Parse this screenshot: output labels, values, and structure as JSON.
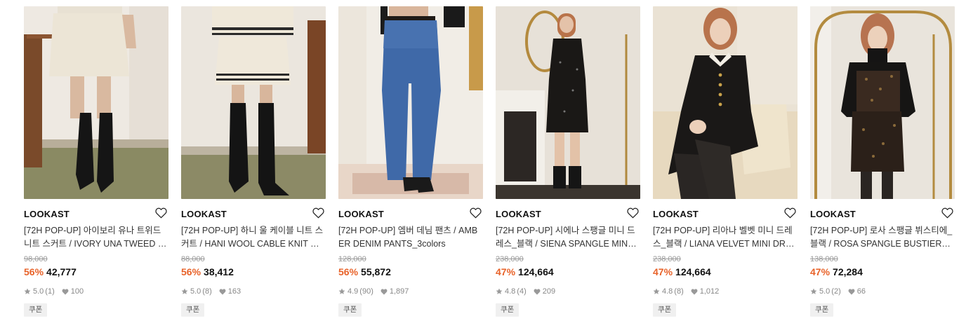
{
  "products": [
    {
      "brand": "LOOKAST",
      "title": "[72H POP-UP] 아이보리 유나 트위드 니트 스커트 / IVORY UNA TWEED KNIT SKIRT",
      "original_price": "98,000",
      "discount": "56%",
      "price": "42,777",
      "rating": "5.0",
      "review_count": "(1)",
      "likes": "100",
      "coupon": "쿠폰"
    },
    {
      "brand": "LOOKAST",
      "title": "[72H POP-UP] 하니 울 케이블 니트 스커트 / HANI WOOL CABLE KNIT SKIRT",
      "original_price": "88,000",
      "discount": "56%",
      "price": "38,412",
      "rating": "5.0",
      "review_count": "(8)",
      "likes": "163",
      "coupon": "쿠폰"
    },
    {
      "brand": "LOOKAST",
      "title": "[72H POP-UP] 엠버 데님 팬츠 / AMBER DENIM PANTS_3colors",
      "original_price": "128,000",
      "discount": "56%",
      "price": "55,872",
      "rating": "4.9",
      "review_count": "(90)",
      "likes": "1,897",
      "coupon": "쿠폰"
    },
    {
      "brand": "LOOKAST",
      "title": "[72H POP-UP] 시에나 스팽글 미니 드레스_블랙 / SIENA SPANGLE MINI DRESS_BLACK",
      "original_price": "238,000",
      "discount": "47%",
      "price": "124,664",
      "rating": "4.8",
      "review_count": "(4)",
      "likes": "209",
      "coupon": "쿠폰"
    },
    {
      "brand": "LOOKAST",
      "title": "[72H POP-UP] 리아나 벨벳 미니 드레스_블랙 / LIANA VELVET MINI DRESS_BLACK",
      "original_price": "238,000",
      "discount": "47%",
      "price": "124,664",
      "rating": "4.8",
      "review_count": "(8)",
      "likes": "1,012",
      "coupon": "쿠폰"
    },
    {
      "brand": "LOOKAST",
      "title": "[72H POP-UP] 로사 스팽글 뷔스티에_블랙 / ROSA SPANGLE BUSTIER_BLACK",
      "original_price": "138,000",
      "discount": "47%",
      "price": "72,284",
      "rating": "5.0",
      "review_count": "(2)",
      "likes": "66",
      "coupon": "쿠폰"
    }
  ],
  "colors": {
    "discount": "#e8632a",
    "price": "#111111",
    "muted": "#999999",
    "coupon_bg": "#f0f0f0"
  },
  "icons": {
    "wishlist": "heart-outline-icon",
    "rating": "star-icon",
    "likes": "heart-filled-icon"
  }
}
